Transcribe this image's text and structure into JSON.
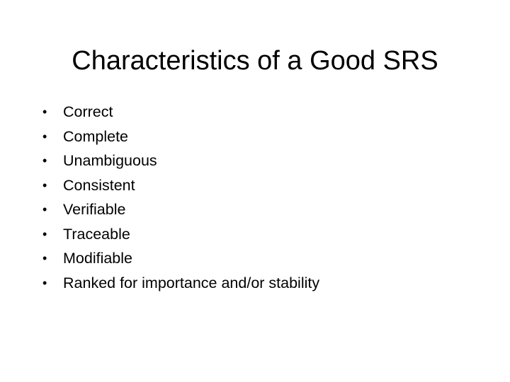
{
  "slide": {
    "title": "Characteristics of a Good SRS",
    "bullet_glyph": "•",
    "bullets": [
      {
        "text": "Correct"
      },
      {
        "text": "Complete"
      },
      {
        "text": "Unambiguous"
      },
      {
        "text": "Consistent"
      },
      {
        "text": "Verifiable"
      },
      {
        "text": "Traceable"
      },
      {
        "text": "Modifiable"
      },
      {
        "text": "Ranked for importance and/or stability"
      }
    ]
  }
}
